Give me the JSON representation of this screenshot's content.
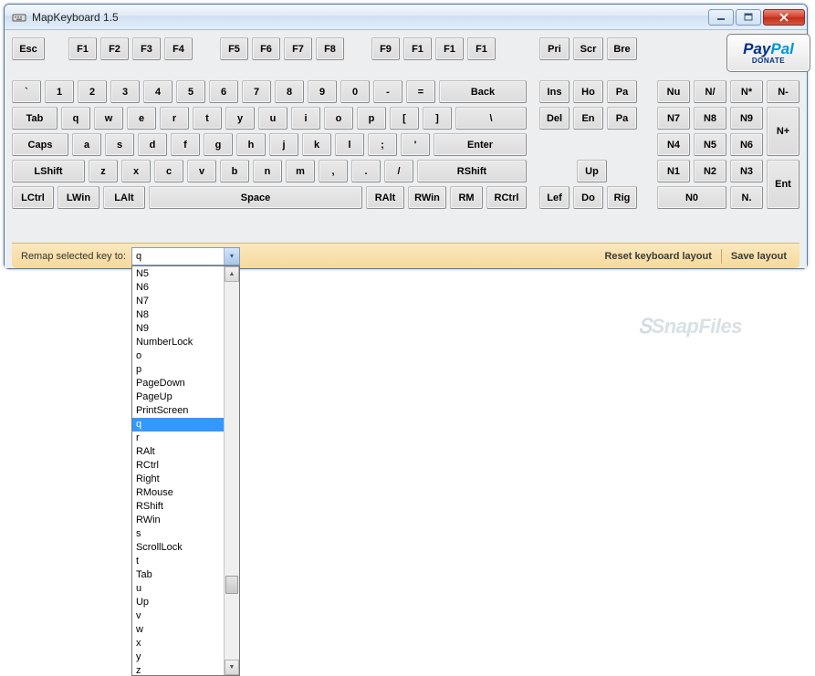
{
  "window": {
    "title": "MapKeyboard 1.5"
  },
  "paypal": {
    "logo_pay": "Pay",
    "logo_pal": "Pal",
    "donate": "DONATE"
  },
  "footer": {
    "label": "Remap selected key to:",
    "combo_value": "q",
    "reset": "Reset keyboard layout",
    "save": "Save layout"
  },
  "dropdown": {
    "items": [
      "N5",
      "N6",
      "N7",
      "N8",
      "N9",
      "NumberLock",
      "o",
      "p",
      "PageDown",
      "PageUp",
      "PrintScreen",
      "q",
      "r",
      "RAlt",
      "RCtrl",
      "Right",
      "RMouse",
      "RShift",
      "RWin",
      "s",
      "ScrollLock",
      "t",
      "Tab",
      "u",
      "Up",
      "v",
      "w",
      "x",
      "y",
      "z"
    ],
    "selected": "q"
  },
  "watermark": "SnapFiles",
  "keys": {
    "fn_row": [
      "Esc",
      "F1",
      "F2",
      "F3",
      "F4",
      "F5",
      "F6",
      "F7",
      "F8",
      "F9",
      "F1",
      "F1",
      "F1",
      "Pri",
      "Scr",
      "Bre"
    ],
    "r1": [
      "`",
      "1",
      "2",
      "3",
      "4",
      "5",
      "6",
      "7",
      "8",
      "9",
      "0",
      "-",
      "=",
      "Back"
    ],
    "r2": [
      "Tab",
      "q",
      "w",
      "e",
      "r",
      "t",
      "y",
      "u",
      "i",
      "o",
      "p",
      "[",
      "]",
      "\\"
    ],
    "r3": [
      "Caps",
      "a",
      "s",
      "d",
      "f",
      "g",
      "h",
      "j",
      "k",
      "l",
      ";",
      "'",
      "Enter"
    ],
    "r4": [
      "LShift",
      "z",
      "x",
      "c",
      "v",
      "b",
      "n",
      "m",
      ",",
      ".",
      "/",
      "RShift"
    ],
    "r5": [
      "LCtrl",
      "LWin",
      "LAlt",
      "Space",
      "RAlt",
      "RWin",
      "RM",
      "RCtrl"
    ],
    "nav1": [
      "Ins",
      "Ho",
      "Pa"
    ],
    "nav2": [
      "Del",
      "En",
      "Pa"
    ],
    "nav3": [
      "Up"
    ],
    "nav4": [
      "Lef",
      "Do",
      "Rig"
    ],
    "np_top": [
      "Nu",
      "N/",
      "N*",
      "N-"
    ],
    "np": [
      "N7",
      "N8",
      "N9",
      "N+",
      "N4",
      "N5",
      "N6",
      "N1",
      "N2",
      "N3",
      "Ent",
      "N0",
      "N."
    ]
  }
}
